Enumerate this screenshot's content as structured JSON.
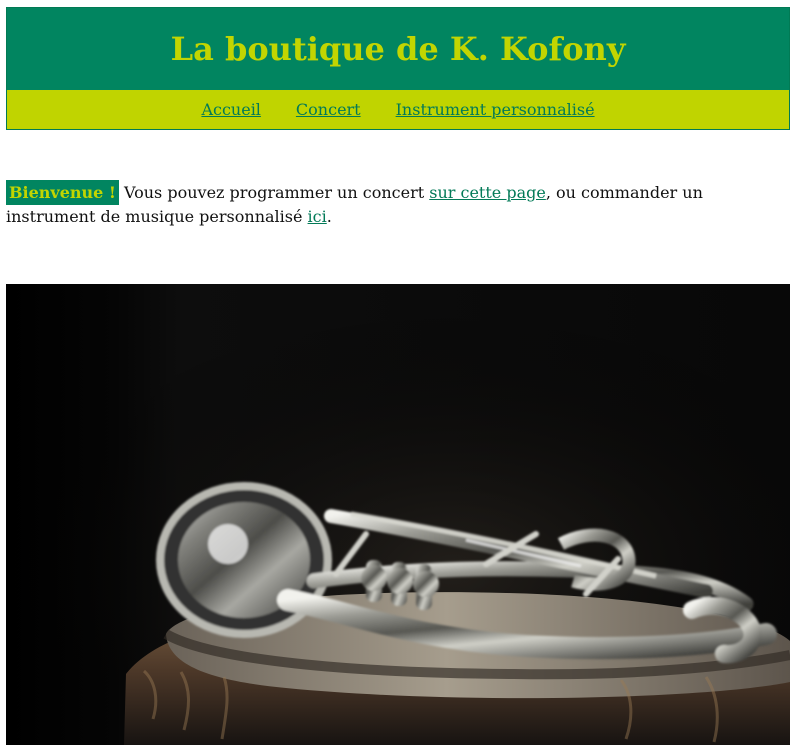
{
  "header": {
    "title": "La boutique de K. Kofony"
  },
  "nav": {
    "items": [
      {
        "label": "Accueil"
      },
      {
        "label": "Concert"
      },
      {
        "label": "Instrument personnalisé"
      }
    ]
  },
  "welcome": {
    "badge": "Bienvenue !",
    "text_before_link_1": "Vous pouvez programmer un concert",
    "link_1": "sur cette page",
    "text_between_links": ", ou commander un instrument de musique personnalisé",
    "link_2": "ici",
    "text_after_link_2": "."
  },
  "colors": {
    "header_green": "#018560",
    "accent_yellow": "#c2d501",
    "nav_yellow": "#c0d400",
    "link_green": "#027a57"
  },
  "hero_image": {
    "subject": "trumpet-on-drum-photo"
  }
}
